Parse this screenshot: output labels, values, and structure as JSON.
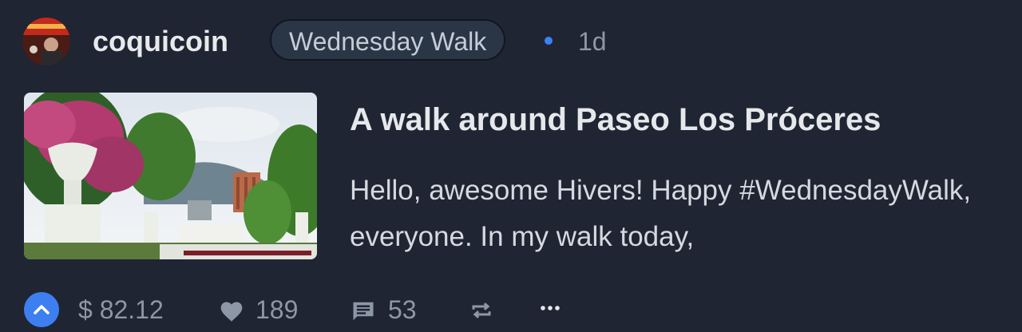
{
  "post": {
    "author": "coquicoin",
    "community": "Wednesday Walk",
    "time_ago": "1d",
    "title": "A walk around Paseo Los Próceres",
    "excerpt": "Hello, awesome Hivers! Happy #WednesdayWalk, everyone. In my walk today,",
    "payout": "$ 82.12",
    "votes": "189",
    "comments": "53"
  },
  "icons": {
    "upvote": "chevron-up-icon",
    "likes": "heart-icon",
    "comments": "comment-icon",
    "reblog": "repeat-icon",
    "more": "more-horizontal-icon"
  },
  "colors": {
    "background": "#1f2532",
    "accent": "#3d7ff0",
    "muted_text": "#8e97a6",
    "badge_bg": "#2a3546"
  }
}
